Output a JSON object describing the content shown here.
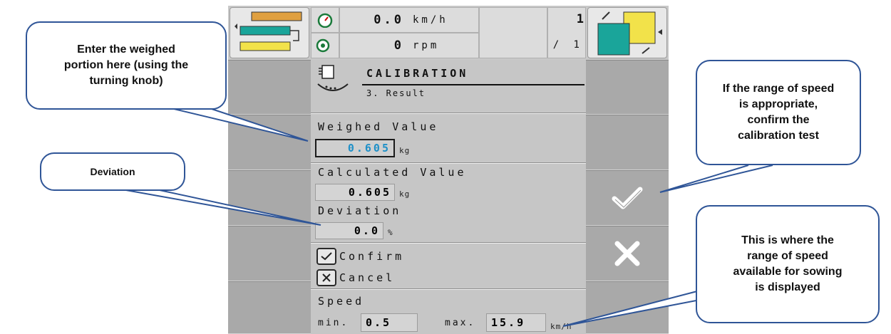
{
  "header": {
    "speed_value": "0.0",
    "speed_unit": "km/h",
    "rpm_value": "0",
    "rpm_unit": "rpm",
    "counter_top": "1",
    "counter_bottom": "/ 1",
    "rpm_icon_num": "1"
  },
  "screen": {
    "title": "CALIBRATION",
    "subtitle": "3. Result"
  },
  "weighed": {
    "label": "Weighed Value",
    "value": "0.605",
    "unit": "kg"
  },
  "calculated": {
    "label": "Calculated Value",
    "value": "0.605",
    "unit": "kg"
  },
  "deviation": {
    "label": "Deviation",
    "value": "0.0",
    "unit": "%"
  },
  "actions": {
    "confirm_label": "Confirm",
    "cancel_label": "Cancel"
  },
  "speed_range": {
    "label": "Speed",
    "min_label": "min.",
    "min_value": "0.5",
    "max_label": "max.",
    "max_value": "15.9",
    "unit": "km/h"
  },
  "callouts": {
    "weighed_line1": "Enter the weighed",
    "weighed_line2": "portion here (using the",
    "weighed_line3": "turning knob)",
    "deviation": "Deviation",
    "confirm_line1": "If the range of speed",
    "confirm_line2": "is appropriate,",
    "confirm_line3": "confirm the",
    "confirm_line4": "calibration test",
    "range_line1": "This is where the",
    "range_line2": "range of speed",
    "range_line3": "available for sowing",
    "range_line4": "is displayed"
  },
  "colors": {
    "accent_value": "#1e90c8",
    "callout_border": "#2f5597",
    "icon_teal": "#1aa59a",
    "icon_yellow": "#f2e24a",
    "icon_orange": "#e0a040"
  }
}
